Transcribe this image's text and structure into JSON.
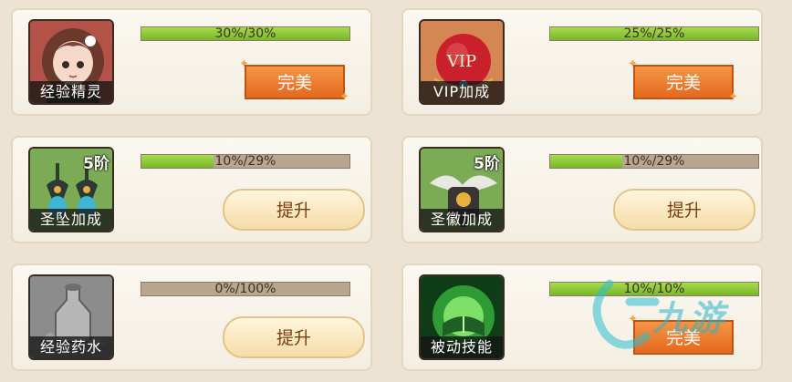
{
  "cards": [
    {
      "name": "经验精灵",
      "tier": "",
      "progress_text": "30%/30%",
      "fill": 1.0,
      "button": "完美",
      "button_type": "perfect",
      "icon": "fairy-icon"
    },
    {
      "name": "VIP加成",
      "tier": "",
      "progress_text": "25%/25%",
      "fill": 1.0,
      "button": "完美",
      "button_type": "perfect",
      "icon": "vip-orb-icon",
      "icon_text": "VIP"
    },
    {
      "name": "圣坠加成",
      "tier": "5阶",
      "progress_text": "10%/29%",
      "fill": 0.345,
      "button": "提升",
      "button_type": "upgrade",
      "icon": "earrings-icon"
    },
    {
      "name": "圣徽加成",
      "tier": "5阶",
      "progress_text": "10%/29%",
      "fill": 0.345,
      "button": "提升",
      "button_type": "upgrade",
      "icon": "emblem-icon"
    },
    {
      "name": "经验药水",
      "tier": "",
      "progress_text": "0%/100%",
      "fill": 0.0,
      "button": "提升",
      "button_type": "upgrade",
      "icon": "potion-icon"
    },
    {
      "name": "被动技能",
      "tier": "",
      "progress_text": "10%/10%",
      "fill": 1.0,
      "button": "完美",
      "button_type": "perfect",
      "icon": "skill-book-icon"
    }
  ],
  "watermark": "九游"
}
